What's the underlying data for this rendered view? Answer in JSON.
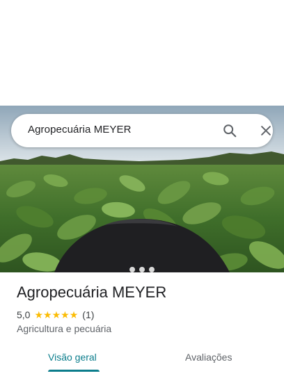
{
  "search": {
    "query": "Agropecuária MEYER",
    "search_icon": "search-icon",
    "close_icon": "close-icon"
  },
  "place": {
    "title": "Agropecuária MEYER",
    "rating": "5,0",
    "stars": 5,
    "review_count": "(1)",
    "category": "Agricultura e pecuária"
  },
  "tabs": [
    {
      "label": "Visão geral",
      "active": true
    },
    {
      "label": "Avaliações",
      "active": false
    }
  ],
  "colors": {
    "accent": "#0b7d8c",
    "star": "#fbbc04"
  }
}
